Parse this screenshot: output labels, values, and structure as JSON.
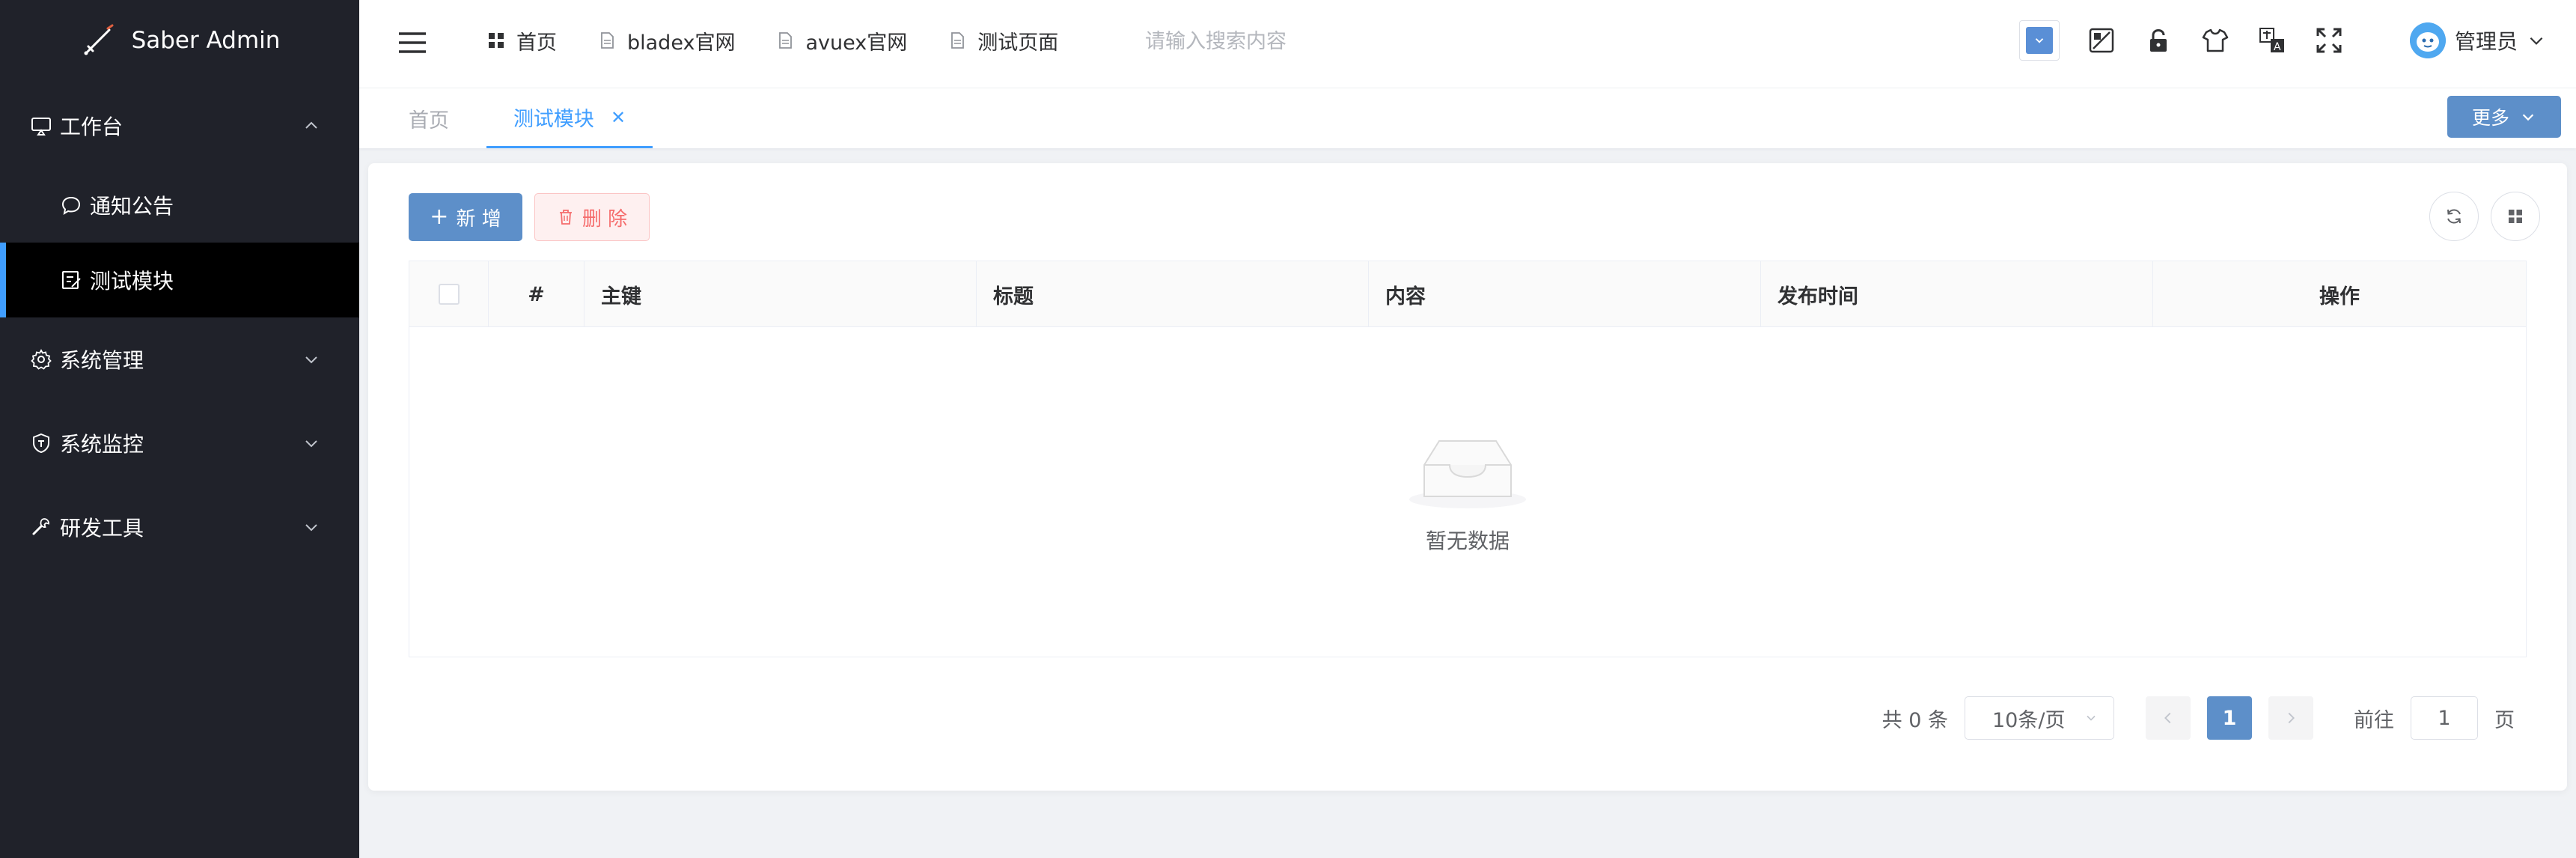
{
  "app": {
    "title": "Saber Admin"
  },
  "sidebar": {
    "items": [
      {
        "label": "工作台",
        "icon": "monitor-icon",
        "expanded": true
      },
      {
        "label": "通知公告",
        "icon": "chat-icon"
      },
      {
        "label": "测试模块",
        "icon": "edit-icon",
        "active": true
      },
      {
        "label": "系统管理",
        "icon": "gear-icon"
      },
      {
        "label": "系统监控",
        "icon": "shield-icon"
      },
      {
        "label": "研发工具",
        "icon": "wrench-icon"
      }
    ]
  },
  "header": {
    "nav": [
      {
        "label": "首页",
        "icon": "grid-icon"
      },
      {
        "label": "bladex官网",
        "icon": "document-icon"
      },
      {
        "label": "avuex官网",
        "icon": "document-icon"
      },
      {
        "label": "测试页面",
        "icon": "document-icon"
      }
    ],
    "search": {
      "placeholder": "请输入搜索内容"
    },
    "user": {
      "name": "管理员"
    }
  },
  "tabs": {
    "items": [
      {
        "label": "首页"
      },
      {
        "label": "测试模块",
        "active": true
      }
    ],
    "more_label": "更多"
  },
  "toolbar": {
    "add_label": "新 增",
    "delete_label": "删 除"
  },
  "table": {
    "columns": [
      "#",
      "主键",
      "标题",
      "内容",
      "发布时间",
      "操作"
    ],
    "rows": [],
    "empty_text": "暂无数据"
  },
  "pagination": {
    "total_text": "共 0 条",
    "page_size": "10条/页",
    "current_page": "1",
    "goto_prefix": "前往",
    "goto_value": "1",
    "goto_suffix": "页"
  },
  "colors": {
    "sidebar_bg": "#20222a",
    "primary": "#409eff",
    "button_blue": "#5d8fc9",
    "danger": "#f56c6c"
  }
}
